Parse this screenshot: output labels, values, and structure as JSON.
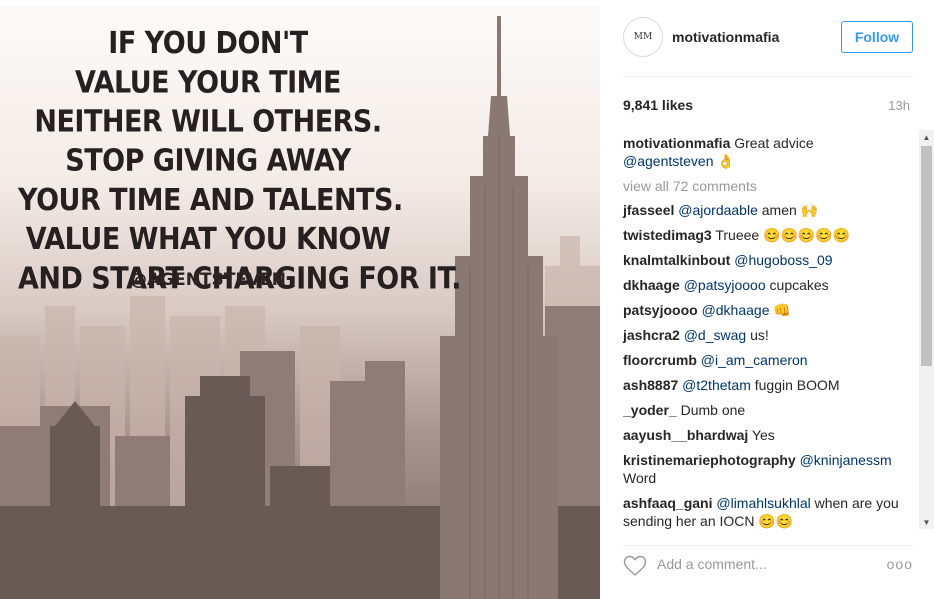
{
  "post": {
    "image_quote_lines": [
      "IF YOU DON'T",
      "VALUE YOUR TIME",
      "NEITHER WILL OTHERS.",
      "STOP GIVING AWAY",
      "YOUR TIME AND TALENTS.",
      "VALUE WHAT YOU KNOW",
      "AND START CHARGING FOR IT."
    ],
    "image_handle": "@AGENTSTEVEN"
  },
  "header": {
    "avatar_text": "MM",
    "username": "motivationmafia",
    "follow_label": "Follow"
  },
  "meta": {
    "likes": "9,841 likes",
    "time": "13h"
  },
  "caption": {
    "user": "motivationmafia",
    "text": "Great advice",
    "mention": "@agentsteven",
    "emoji": "👌"
  },
  "view_all": "view all 72 comments",
  "comments": [
    {
      "user": "jfasseel",
      "mention": "@ajordaable",
      "text": "amen 🙌"
    },
    {
      "user": "twistedimag3",
      "mention": "",
      "text": "Trueee 😊😊😊😊😊"
    },
    {
      "user": "knalmtalkinbout",
      "mention": "@hugoboss_09",
      "text": ""
    },
    {
      "user": "dkhaage",
      "mention": "@patsyjoooo",
      "text": "cupcakes"
    },
    {
      "user": "patsyjoooo",
      "mention": "@dkhaage",
      "text": "👊"
    },
    {
      "user": "jashcra2",
      "mention": "@d_swag",
      "text": "us!"
    },
    {
      "user": "floorcrumb",
      "mention": "@i_am_cameron",
      "text": ""
    },
    {
      "user": "ash8887",
      "mention": "@t2thetam",
      "text": "fuggin BOOM"
    },
    {
      "user": "_yoder_",
      "mention": "",
      "text": "Dumb one"
    },
    {
      "user": "aayush__bhardwaj",
      "mention": "",
      "text": "Yes"
    },
    {
      "user": "kristinemariephotography",
      "mention": "@kninjanessm",
      "text": "Word"
    },
    {
      "user": "ashfaaq_gani",
      "mention": "@limahlsukhlal",
      "text": "when are you sending her an IOCN 😊😊"
    }
  ],
  "footer": {
    "add_comment_placeholder": "Add a comment...",
    "more_label": "ooo"
  },
  "icons": {
    "heart": "heart-outline-icon",
    "scroll_up": "triangle-up-icon",
    "scroll_down": "triangle-down-icon"
  },
  "colors": {
    "follow_blue": "#3897f0",
    "mention_blue": "#003569",
    "muted_gray": "#999999"
  }
}
